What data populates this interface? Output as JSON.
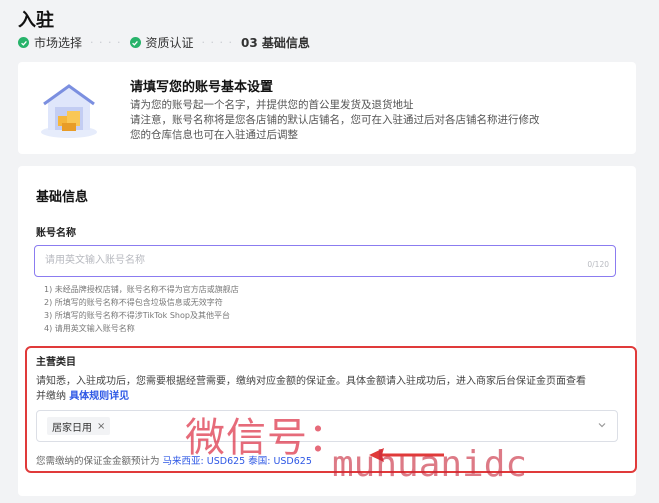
{
  "page": {
    "title": "入驻"
  },
  "steps": [
    {
      "label": "市场选择",
      "status": "done"
    },
    {
      "label": "资质认证",
      "status": "done"
    },
    {
      "label": "03 基础信息",
      "status": "current"
    }
  ],
  "intro": {
    "title": "请填写您的账号基本设置",
    "lines": [
      "请为您的账号起一个名字，并提供您的首公里发货及退货地址",
      "请注意，账号名称将是您各店铺的默认店铺名，您可在入驻通过后对各店铺名称进行修改",
      "您的仓库信息也可在入驻通过后调整"
    ]
  },
  "basic": {
    "section_title": "基础信息",
    "account_label": "账号名称",
    "placeholder": "请用英文输入账号名称",
    "counter": "0/120",
    "rules": [
      "1) 未经品牌授权店铺，账号名称不得为官方店或旗舰店",
      "2) 所填写的账号名称不得包含垃圾信息或无效字符",
      "3) 所填写的账号名称不得涉TikTok Shop及其他平台",
      "4) 请用英文输入账号名称"
    ]
  },
  "category": {
    "title": "主营类目",
    "notice_line1": "请知悉，入驻成功后，您需要根据经营需要，缴纳对应金额的保证金。具体金额请入驻成功后，进入商家后台保证金页面查看",
    "notice_line2_prefix": "并缴纳 ",
    "rules_link": "具体规则详见",
    "selected_tag": "居家日用",
    "tag_close": "×",
    "deposit_prefix": "您需缴纳的保证金金额预计为",
    "deposit_values": "马来西亚: USD625 泰国: USD625"
  },
  "watermark": {
    "text": "微信号：",
    "handle": "muhuanidc"
  },
  "colors": {
    "accent": "#2e58e5",
    "success": "#27b36a",
    "highlight_border": "#e03a3a",
    "focus_border": "#8b7cf0"
  }
}
